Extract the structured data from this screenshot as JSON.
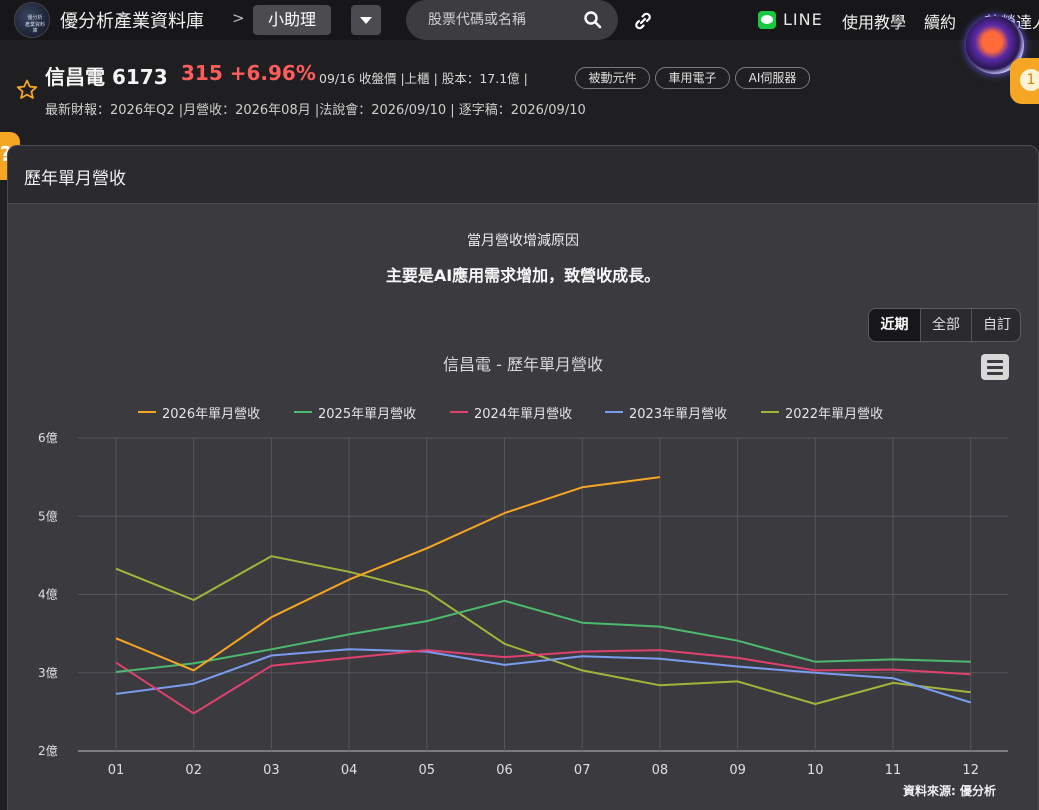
{
  "nav": {
    "logo_line1": "優分析",
    "logo_line2": "產業資料庫",
    "brand": "優分析產業資料庫",
    "separator": ">",
    "helper_label": "小助理",
    "search_placeholder": "股票代碼或名稱",
    "line_label": "LINE",
    "tutorial": "使用教學",
    "subscribe": "續約",
    "more": "尊榮達人"
  },
  "stock": {
    "name": "信昌電 6173",
    "price": "315 +6.96%",
    "info": "09/16 收盤價 |上櫃 | 股本：17.1億 |",
    "tags": [
      "被動元件",
      "車用電子",
      "AI伺服器"
    ],
    "report_dates": "最新財報：2026年Q2 |月營收：2026年08月 |法說會：2026/09/10 | 逐字稿：2026/09/10",
    "badge": "1"
  },
  "panel": {
    "title": "歷年單月營收",
    "reason_label": "當月營收增減原因",
    "reason_text": "主要是AI應用需求增加，致營收成長。",
    "ranges": [
      "近期",
      "全部",
      "自訂"
    ],
    "active_range": "近期",
    "source": "資料來源: 優分析"
  },
  "colors": {
    "s2026": "#f5a623",
    "s2025": "#4cba6e",
    "s2024": "#e0416e",
    "s2023": "#7b9cf0",
    "s2022": "#a3b43a"
  },
  "chart_data": {
    "type": "line",
    "title": "信昌電 - 歷年單月營收",
    "categories": [
      "01",
      "02",
      "03",
      "04",
      "05",
      "06",
      "07",
      "08",
      "09",
      "10",
      "11",
      "12"
    ],
    "y_ticks": [
      "2億",
      "3億",
      "4億",
      "5億",
      "6億"
    ],
    "ylim": [
      2,
      6
    ],
    "unit": "億",
    "grid": true,
    "legend_position": "top",
    "series": [
      {
        "name": "2026年單月營收",
        "color": "#f5a623",
        "values": [
          3.44,
          3.03,
          3.71,
          4.19,
          4.59,
          5.04,
          5.37,
          5.5,
          null,
          null,
          null,
          null
        ]
      },
      {
        "name": "2025年單月營收",
        "color": "#4cba6e",
        "values": [
          3.01,
          3.12,
          3.3,
          3.49,
          3.66,
          3.92,
          3.64,
          3.59,
          3.41,
          3.14,
          3.17,
          3.14
        ]
      },
      {
        "name": "2024年單月營收",
        "color": "#e0416e",
        "values": [
          3.13,
          2.48,
          3.09,
          3.19,
          3.29,
          3.2,
          3.27,
          3.29,
          3.19,
          3.03,
          3.04,
          2.98
        ]
      },
      {
        "name": "2023年單月營收",
        "color": "#7b9cf0",
        "values": [
          2.73,
          2.86,
          3.22,
          3.3,
          3.27,
          3.1,
          3.21,
          3.18,
          3.08,
          3.0,
          2.93,
          2.62
        ]
      },
      {
        "name": "2022年單月營收",
        "color": "#a3b43a",
        "values": [
          4.33,
          3.93,
          4.49,
          4.29,
          4.04,
          3.37,
          3.03,
          2.84,
          2.89,
          2.6,
          2.87,
          2.75
        ]
      }
    ]
  }
}
